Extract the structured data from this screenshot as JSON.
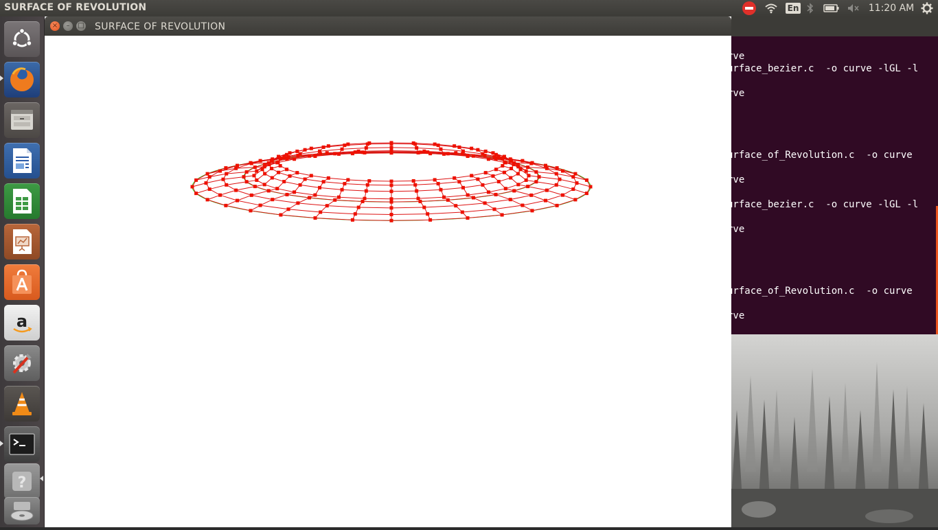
{
  "top_panel": {
    "title": "SURFACE OF REVOLUTION",
    "language": "En",
    "clock": "11:20 AM"
  },
  "launcher": {
    "items": [
      {
        "name": "Ubuntu Dash",
        "icon": "ubuntu-logo-icon"
      },
      {
        "name": "Firefox",
        "icon": "firefox-icon"
      },
      {
        "name": "Files",
        "icon": "files-icon"
      },
      {
        "name": "LibreOffice Writer",
        "icon": "writer-icon"
      },
      {
        "name": "LibreOffice Calc",
        "icon": "calc-icon"
      },
      {
        "name": "LibreOffice Impress",
        "icon": "impress-icon"
      },
      {
        "name": "Ubuntu Software Center",
        "icon": "software-center-icon"
      },
      {
        "name": "Amazon",
        "icon": "amazon-icon"
      },
      {
        "name": "System Settings",
        "icon": "settings-icon"
      },
      {
        "name": "VLC",
        "icon": "vlc-icon"
      },
      {
        "name": "Terminal",
        "icon": "terminal-icon"
      },
      {
        "name": "Unknown application",
        "icon": "help-icon"
      },
      {
        "name": "DVD Drive",
        "icon": "disc-icon"
      }
    ]
  },
  "app_window": {
    "title": "SURFACE OF REVOLUTION",
    "mesh_colors": {
      "edges": "#dd1111",
      "control_points": "#ee1100",
      "guide_curve": "#22cc22"
    }
  },
  "terminal": {
    "lines": [
      "rve",
      "urface_bezier.c  -o curve -lGL -l",
      "rve",
      "urface_of_Revolution.c  -o curve",
      "rve",
      "urface_bezier.c  -o curve -lGL -l",
      "rve",
      "urface_of_Revolution.c  -o curve",
      "rve"
    ]
  },
  "colors": {
    "panel": "#3c3b37",
    "launcher": "#443f41",
    "terminal_bg": "#300a24",
    "accent_orange": "#e9541e"
  }
}
